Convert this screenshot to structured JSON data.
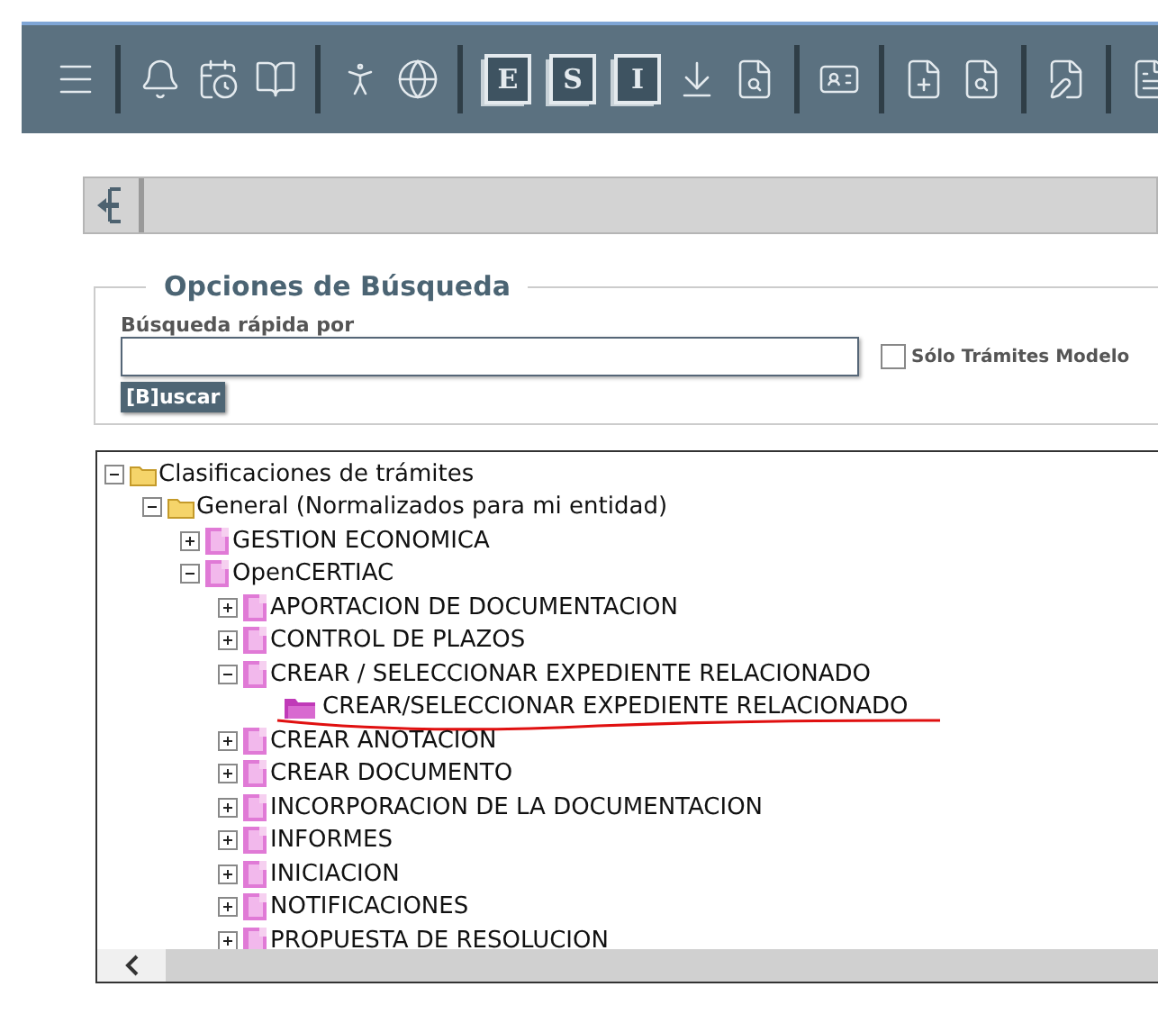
{
  "toolbar": {
    "groups": [
      {
        "items": [
          {
            "kind": "menu"
          }
        ]
      },
      {
        "items": [
          {
            "kind": "bell"
          },
          {
            "kind": "calendar"
          },
          {
            "kind": "books"
          }
        ]
      },
      {
        "items": [
          {
            "kind": "person"
          },
          {
            "kind": "globe"
          }
        ]
      },
      {
        "items": [
          {
            "kind": "letter",
            "label": "E"
          },
          {
            "kind": "letter",
            "label": "S"
          },
          {
            "kind": "letter",
            "label": "I"
          },
          {
            "kind": "download"
          },
          {
            "kind": "docsearch"
          }
        ]
      },
      {
        "items": [
          {
            "kind": "cardsearch"
          }
        ]
      },
      {
        "items": [
          {
            "kind": "docplus"
          },
          {
            "kind": "docsearch"
          }
        ]
      },
      {
        "items": [
          {
            "kind": "docedit"
          }
        ]
      },
      {
        "items": [
          {
            "kind": "doclist"
          }
        ]
      }
    ]
  },
  "search": {
    "legend": "Opciones de Búsqueda",
    "label": "Búsqueda rápida por",
    "button": "[B]uscar",
    "checkbox": {
      "label": "Sólo Trámites Modelo",
      "checked": false
    }
  },
  "tree": [
    {
      "label": "Clasificaciones de trámites",
      "kind": "folder",
      "expanded": true,
      "children": [
        {
          "label": "General (Normalizados para mi entidad)",
          "kind": "folder",
          "expanded": true,
          "children": [
            {
              "label": "GESTION ECONOMICA",
              "kind": "group",
              "expanded": false
            },
            {
              "label": "OpenCERTIAC",
              "kind": "group",
              "expanded": true,
              "children": [
                {
                  "label": "APORTACION DE DOCUMENTACION",
                  "kind": "group",
                  "expanded": false
                },
                {
                  "label": "CONTROL DE PLAZOS",
                  "kind": "group",
                  "expanded": false
                },
                {
                  "label": "CREAR / SELECCIONAR EXPEDIENTE RELACIONADO",
                  "kind": "group",
                  "expanded": true,
                  "children": [
                    {
                      "label": "CREAR/SELECCIONAR EXPEDIENTE RELACIONADO",
                      "kind": "leaf",
                      "underlined": true
                    }
                  ]
                },
                {
                  "label": "CREAR ANOTACION",
                  "kind": "group",
                  "expanded": false
                },
                {
                  "label": "CREAR DOCUMENTO",
                  "kind": "group",
                  "expanded": false
                },
                {
                  "label": "INCORPORACION DE LA DOCUMENTACION",
                  "kind": "group",
                  "expanded": false
                },
                {
                  "label": "INFORMES",
                  "kind": "group",
                  "expanded": false
                },
                {
                  "label": "INICIACION",
                  "kind": "group",
                  "expanded": false
                },
                {
                  "label": "NOTIFICACIONES",
                  "kind": "group",
                  "expanded": false
                },
                {
                  "label": "PROPUESTA DE RESOLUCION",
                  "kind": "group",
                  "expanded": false
                }
              ]
            }
          ]
        }
      ]
    }
  ]
}
